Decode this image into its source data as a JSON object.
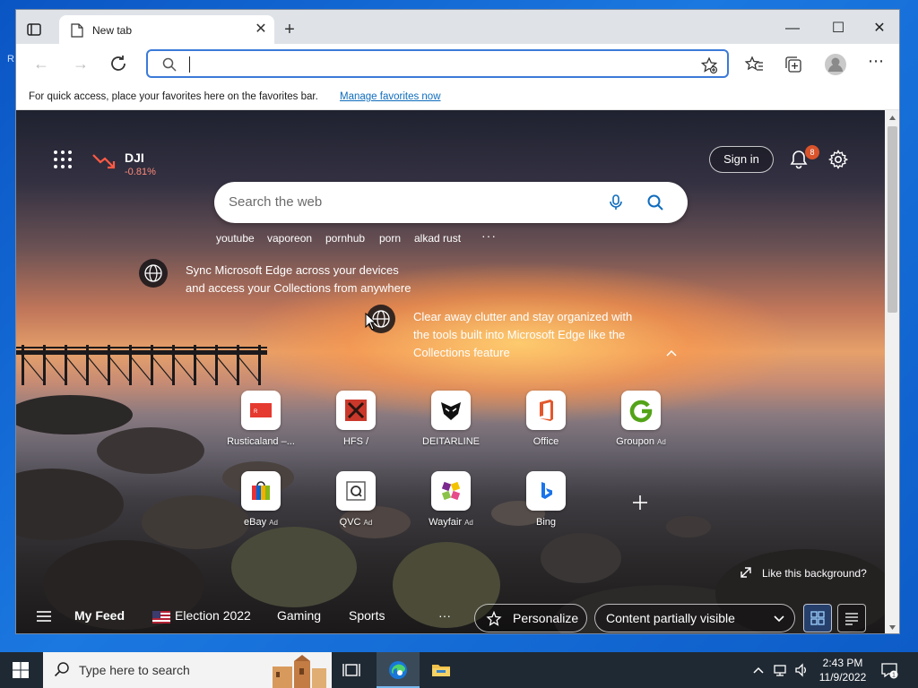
{
  "desktop": {
    "edge_letter": "R"
  },
  "browser": {
    "tab_title": "New tab",
    "favorites_bar": {
      "message": "For quick access, place your favorites here on the favorites bar.",
      "link": "Manage favorites now"
    }
  },
  "ntp": {
    "stock": {
      "name": "DJI",
      "change": "-0.81%"
    },
    "sign_in": "Sign in",
    "notification_count": "8",
    "search_placeholder": "Search the web",
    "trending": [
      "youtube",
      "vaporeon",
      "pornhub",
      "porn",
      "alkad rust"
    ],
    "more": "···",
    "tips": [
      "Sync Microsoft Edge across your devices and access your Collections from anywhere",
      "Clear away clutter and stay organized with the tools built into Microsoft Edge like the Collections feature"
    ],
    "tiles": [
      {
        "label": "Rusticaland –...",
        "ad": ""
      },
      {
        "label": "HFS /",
        "ad": ""
      },
      {
        "label": "DEITARLINE",
        "ad": ""
      },
      {
        "label": "Office",
        "ad": ""
      },
      {
        "label": "Groupon",
        "ad": "Ad"
      },
      {
        "label": "eBay",
        "ad": "Ad"
      },
      {
        "label": "QVC",
        "ad": "Ad"
      },
      {
        "label": "Wayfair",
        "ad": "Ad"
      },
      {
        "label": "Bing",
        "ad": ""
      }
    ],
    "like_background": "Like this background?",
    "feed": {
      "my_feed": "My Feed",
      "items": [
        "Election 2022",
        "Gaming",
        "Sports"
      ],
      "more": "···",
      "personalize": "Personalize",
      "content_visibility": "Content partially visible"
    }
  },
  "taskbar": {
    "search_text": "Type here to search",
    "time": "2:43 PM",
    "date": "11/9/2022",
    "notification_count": "1"
  },
  "colors": {
    "accent": "#0f6cbd",
    "taskbar": "#1f2933",
    "stock_down": "#ff5a45"
  }
}
